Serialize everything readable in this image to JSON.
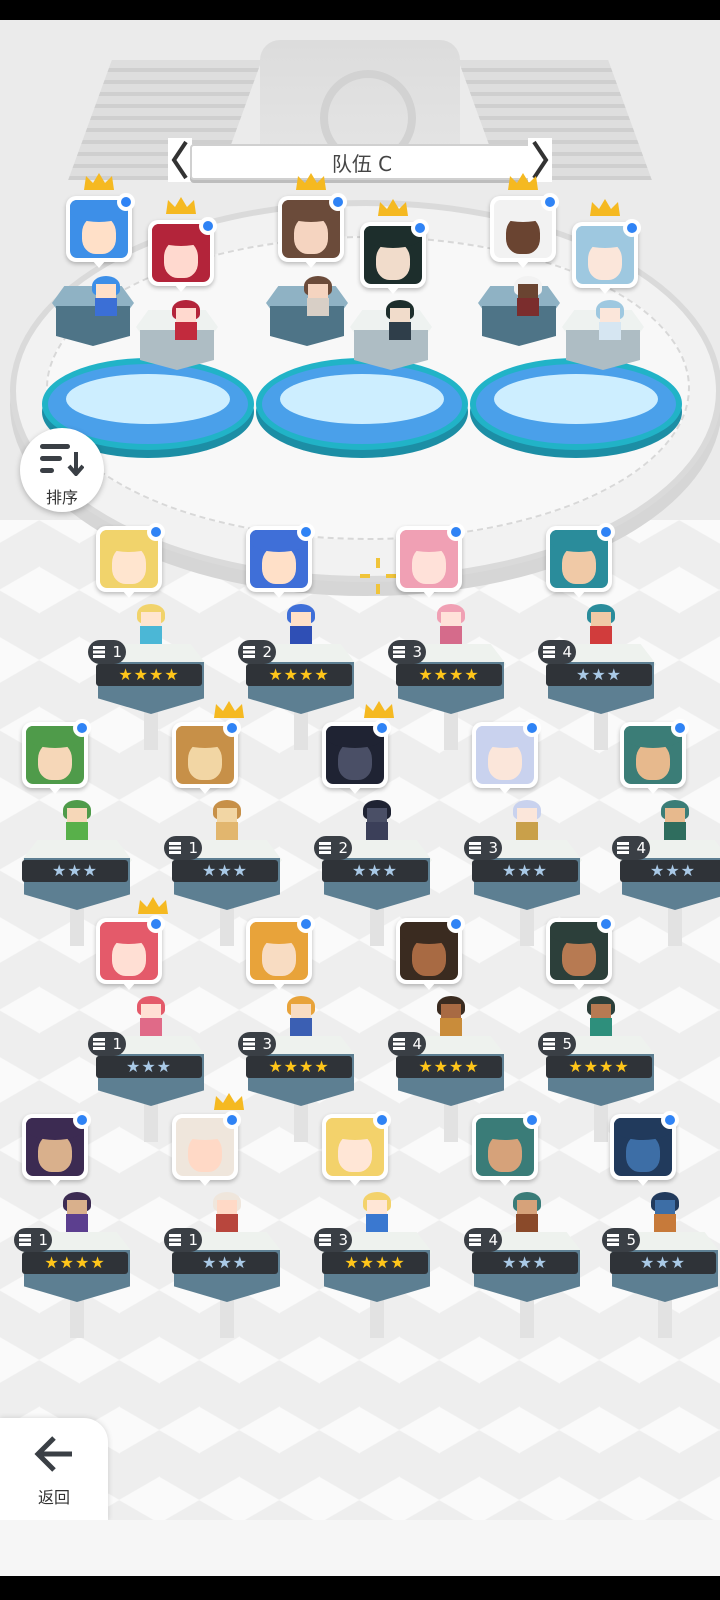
{
  "team": {
    "title": "队伍 C"
  },
  "sort_button": {
    "label": "排序"
  },
  "back_button": {
    "label": "返回"
  },
  "icons": {
    "prev": "chevron-left-icon",
    "next": "chevron-right-icon",
    "sort": "sort-icon",
    "back": "arrow-left-icon",
    "crown": "crown-icon",
    "selected": "selected-dot-icon",
    "target": "crosshair-icon"
  },
  "colors": {
    "pad_blue": "#4aa0ea",
    "pad_rim": "#21b3c7",
    "star_gold": "#ffc61a",
    "star_silver": "#a9c9e6",
    "badge_blue": "#2f83f5",
    "crown_gold": "#f5b921"
  },
  "team_slots": [
    {
      "skin": "#ffe0c8",
      "hair": "#3d8fe8",
      "cloth": "#3b6fd6",
      "crown": true
    },
    {
      "skin": "#ffd9cf",
      "hair": "#b3243a",
      "cloth": "#c22a3d",
      "crown": true
    },
    {
      "skin": "#f5d4c0",
      "hair": "#6b4b3a",
      "cloth": "#d8cfc6",
      "crown": true
    },
    {
      "skin": "#f1dccb",
      "hair": "#1d2e2c",
      "cloth": "#2f3e4a",
      "crown": true
    },
    {
      "skin": "#6a4431",
      "hair": "#f2f2f2",
      "cloth": "#7b2d2d",
      "crown": true
    },
    {
      "skin": "#fbe6da",
      "hair": "#9ec8e0",
      "cloth": "#d6e6f2",
      "crown": true
    }
  ],
  "roster_rows": [
    [
      {
        "level": "1",
        "stars": "★★★★",
        "gold": true,
        "skin": "#ffe5cf",
        "hair": "#f1d36b",
        "cloth": "#4bb7d6",
        "crown": false
      },
      {
        "level": "2",
        "stars": "★★★★",
        "gold": true,
        "skin": "#ffe0c8",
        "hair": "#3f6fd8",
        "cloth": "#2f4fb5",
        "crown": false
      },
      {
        "level": "3",
        "stars": "★★★★",
        "gold": true,
        "skin": "#ffe1d9",
        "hair": "#f0a0b4",
        "cloth": "#d56b8b",
        "crown": false
      },
      {
        "level": "4",
        "stars": "★★★",
        "gold": false,
        "skin": "#f0c9a6",
        "hair": "#2a8c9b",
        "cloth": "#d13c3c",
        "crown": false
      }
    ],
    [
      {
        "level": "",
        "stars": "★★★",
        "gold": false,
        "skin": "#f6d7b8",
        "hair": "#4f9b4a",
        "cloth": "#58b04a",
        "crown": false
      },
      {
        "level": "1",
        "stars": "★★★",
        "gold": false,
        "skin": "#f2d6a4",
        "hair": "#c79048",
        "cloth": "#e2b66e",
        "crown": true
      },
      {
        "level": "2",
        "stars": "★★★",
        "gold": false,
        "skin": "#4a4f66",
        "hair": "#1f2333",
        "cloth": "#3b3f59",
        "crown": true
      },
      {
        "level": "3",
        "stars": "★★★",
        "gold": false,
        "skin": "#fbe6da",
        "hair": "#c9d2ee",
        "cloth": "#c9a04a",
        "crown": false
      },
      {
        "level": "4",
        "stars": "★★★",
        "gold": false,
        "skin": "#e7b98d",
        "hair": "#3b7d77",
        "cloth": "#2f6d5e",
        "crown": false
      }
    ],
    [
      {
        "level": "1",
        "stars": "★★★",
        "gold": false,
        "skin": "#ffdfd4",
        "hair": "#e45a6a",
        "cloth": "#e06a88",
        "crown": true
      },
      {
        "level": "3",
        "stars": "★★★★",
        "gold": true,
        "skin": "#f8dcc2",
        "hair": "#e8a33a",
        "cloth": "#3b5fb3",
        "crown": false
      },
      {
        "level": "4",
        "stars": "★★★★",
        "gold": true,
        "skin": "#a86a43",
        "hair": "#3a2b20",
        "cloth": "#c98c3a",
        "crown": false
      },
      {
        "level": "5",
        "stars": "★★★★",
        "gold": true,
        "skin": "#b77a52",
        "hair": "#2c3f3a",
        "cloth": "#2e8f7c",
        "crown": false
      }
    ],
    [
      {
        "level": "1",
        "stars": "★★★★",
        "gold": true,
        "skin": "#d9b08c",
        "hair": "#3c2b52",
        "cloth": "#5c3f8f",
        "crown": false
      },
      {
        "level": "1",
        "stars": "★★★",
        "gold": false,
        "skin": "#ffd9c6",
        "hair": "#efe6dc",
        "cloth": "#b8463d",
        "crown": true
      },
      {
        "level": "3",
        "stars": "★★★★",
        "gold": true,
        "skin": "#ffe6d6",
        "hair": "#f3d26b",
        "cloth": "#3a78d0",
        "crown": false
      },
      {
        "level": "4",
        "stars": "★★★",
        "gold": false,
        "skin": "#d6a27a",
        "hair": "#3a7c78",
        "cloth": "#8a4a2a",
        "crown": false
      },
      {
        "level": "5",
        "stars": "★★★",
        "gold": false,
        "skin": "#3d6ea6",
        "hair": "#213a5c",
        "cloth": "#c77a3a",
        "crown": false
      }
    ]
  ]
}
